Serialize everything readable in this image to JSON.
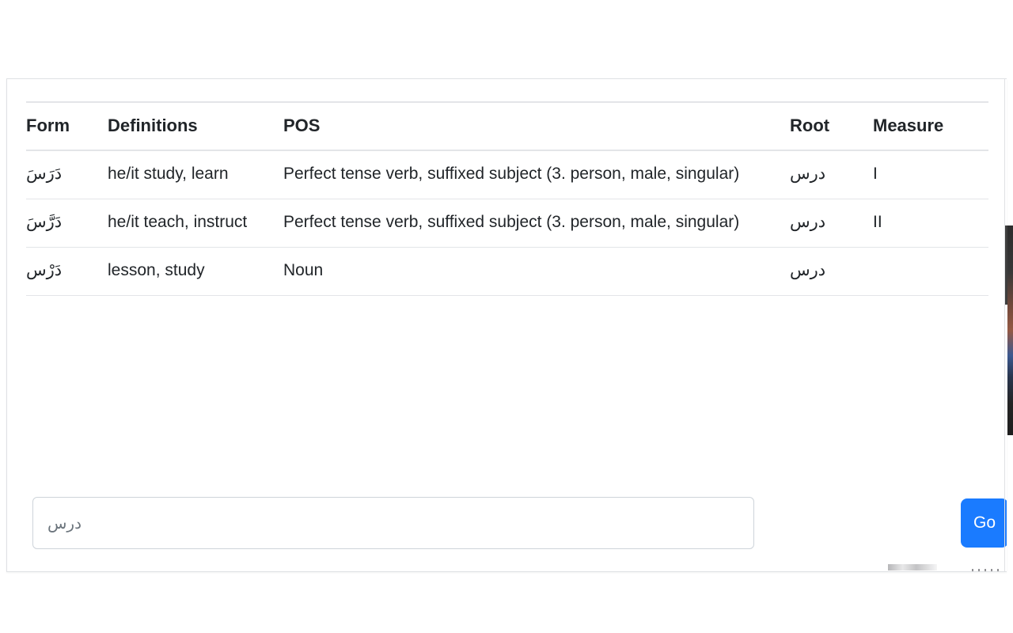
{
  "page": {
    "background_color": "#ffffff",
    "card_border_color": "#dfe1e4"
  },
  "table": {
    "headers": {
      "form": "Form",
      "definitions": "Definitions",
      "pos": "POS",
      "root": "Root",
      "measure": "Measure"
    },
    "rows": [
      {
        "form": "دَرَسَ",
        "definitions": "he/it study, learn",
        "pos": "Perfect tense verb, suffixed subject (3. person, male, singular)",
        "root": "درس",
        "measure": "I"
      },
      {
        "form": "دَرَّسَ",
        "definitions": "he/it teach, instruct",
        "pos": "Perfect tense verb, suffixed subject (3. person, male, singular)",
        "root": "درس",
        "measure": "II"
      },
      {
        "form": "دَرْس",
        "definitions": "lesson, study",
        "pos": "Noun",
        "root": "درس",
        "measure": ""
      }
    ]
  },
  "search": {
    "value": "درس",
    "placeholder": "درس",
    "go_label": "Go",
    "go_color": "#1a7bff"
  }
}
